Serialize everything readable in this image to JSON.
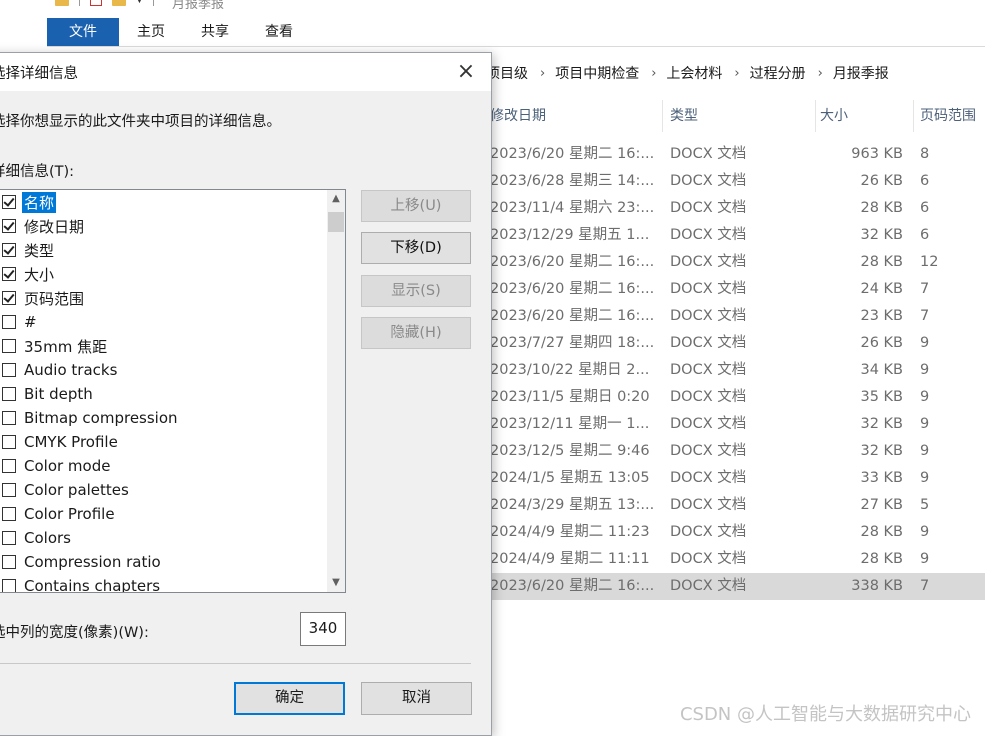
{
  "window": {
    "title": "月报季报",
    "ribbon_tabs": [
      "文件",
      "主页",
      "共享",
      "查看"
    ]
  },
  "breadcrumb": [
    "项目级",
    "项目中期检查",
    "上会材料",
    "过程分册",
    "月报季报"
  ],
  "columns": {
    "date": "修改日期",
    "type": "类型",
    "size": "大小",
    "pages": "页码范围"
  },
  "files": [
    {
      "date": "2023/6/20 星期二 16:...",
      "type": "DOCX 文档",
      "size": "963 KB",
      "pages": "8"
    },
    {
      "date": "2023/6/28 星期三 14:...",
      "type": "DOCX 文档",
      "size": "26 KB",
      "pages": "6"
    },
    {
      "date": "2023/11/4 星期六 23:...",
      "type": "DOCX 文档",
      "size": "28 KB",
      "pages": "6"
    },
    {
      "date": "2023/12/29 星期五 1...",
      "type": "DOCX 文档",
      "size": "32 KB",
      "pages": "6"
    },
    {
      "date": "2023/6/20 星期二 16:...",
      "type": "DOCX 文档",
      "size": "28 KB",
      "pages": "12"
    },
    {
      "date": "2023/6/20 星期二 16:...",
      "type": "DOCX 文档",
      "size": "24 KB",
      "pages": "7"
    },
    {
      "date": "2023/6/20 星期二 16:...",
      "type": "DOCX 文档",
      "size": "23 KB",
      "pages": "7"
    },
    {
      "date": "2023/7/27 星期四 18:...",
      "type": "DOCX 文档",
      "size": "26 KB",
      "pages": "9"
    },
    {
      "date": "2023/10/22 星期日 2...",
      "type": "DOCX 文档",
      "size": "34 KB",
      "pages": "9"
    },
    {
      "date": "2023/11/5 星期日 0:20",
      "type": "DOCX 文档",
      "size": "35 KB",
      "pages": "9"
    },
    {
      "date": "2023/12/11 星期一 1...",
      "type": "DOCX 文档",
      "size": "32 KB",
      "pages": "9"
    },
    {
      "date": "2023/12/5 星期二 9:46",
      "type": "DOCX 文档",
      "size": "32 KB",
      "pages": "9"
    },
    {
      "date": "2024/1/5 星期五 13:05",
      "type": "DOCX 文档",
      "size": "33 KB",
      "pages": "9"
    },
    {
      "date": "2024/3/29 星期五 13:...",
      "type": "DOCX 文档",
      "size": "27 KB",
      "pages": "5"
    },
    {
      "date": "2024/4/9 星期二 11:23",
      "type": "DOCX 文档",
      "size": "28 KB",
      "pages": "9"
    },
    {
      "date": "2024/4/9 星期二 11:11",
      "type": "DOCX 文档",
      "size": "28 KB",
      "pages": "9"
    },
    {
      "date": "2023/6/20 星期二 16:...",
      "type": "DOCX 文档",
      "size": "338 KB",
      "pages": "7",
      "selected": true
    }
  ],
  "dialog": {
    "title": "选择详细信息",
    "close_icon": "×",
    "description": "选择你想显示的此文件夹中项目的详细信息。",
    "list_label": "详细信息(T):",
    "items": [
      {
        "label": "名称",
        "checked": true,
        "highlighted": true
      },
      {
        "label": "修改日期",
        "checked": true
      },
      {
        "label": "类型",
        "checked": true
      },
      {
        "label": "大小",
        "checked": true
      },
      {
        "label": "页码范围",
        "checked": true
      },
      {
        "label": "#",
        "checked": false
      },
      {
        "label": "35mm 焦距",
        "checked": false
      },
      {
        "label": "Audio tracks",
        "checked": false
      },
      {
        "label": "Bit depth",
        "checked": false
      },
      {
        "label": "Bitmap compression",
        "checked": false
      },
      {
        "label": "CMYK Profile",
        "checked": false
      },
      {
        "label": "Color mode",
        "checked": false
      },
      {
        "label": "Color palettes",
        "checked": false
      },
      {
        "label": "Color Profile",
        "checked": false
      },
      {
        "label": "Colors",
        "checked": false
      },
      {
        "label": "Compression ratio",
        "checked": false
      },
      {
        "label": "Contains chapters",
        "checked": false
      }
    ],
    "buttons": {
      "move_up": "上移(U)",
      "move_down": "下移(D)",
      "show": "显示(S)",
      "hide": "隐藏(H)",
      "ok": "确定",
      "cancel": "取消"
    },
    "width_label": "选中列的宽度(像素)(W):",
    "width_value": "340"
  },
  "watermark": "CSDN @人工智能与大数据研究中心",
  "colors": {
    "accent": "#0078d7",
    "ribbon_file": "#1a62b0",
    "selected_row": "#d9d9d9"
  }
}
